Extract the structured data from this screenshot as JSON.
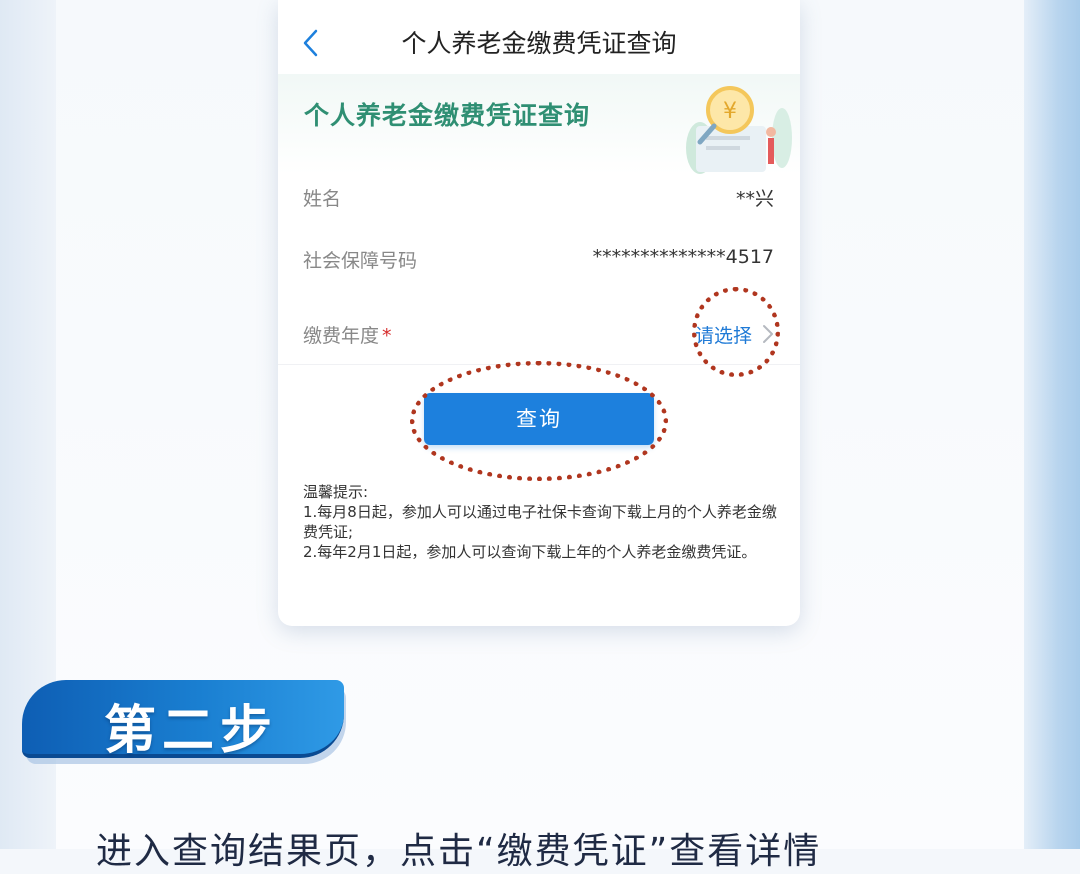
{
  "navbar": {
    "title": "个人养老金缴费凭证查询"
  },
  "banner": {
    "title": "个人养老金缴费凭证查询"
  },
  "form": {
    "name_label": "姓名",
    "name_value": "**兴",
    "ssn_label": "社会保障号码",
    "ssn_value": "**************4517",
    "year_label": "缴费年度",
    "year_required": "*",
    "year_value": "请选择"
  },
  "query_button": "查询",
  "tips": {
    "title": "温馨提示:",
    "line1": "1.每月8日起，参加人可以通过电子社保卡查询下载上月的个人养老金缴费凭证;",
    "line2": "2.每年2月1日起，参加人可以查询下载上年的个人养老金缴费凭证。"
  },
  "step": {
    "label": "第二步"
  },
  "caption": "进入查询结果页，点击“缴费凭证”查看详情",
  "colors": {
    "primary": "#1d80dd",
    "banner_green": "#2f8f73",
    "annotation": "#b0361f"
  }
}
